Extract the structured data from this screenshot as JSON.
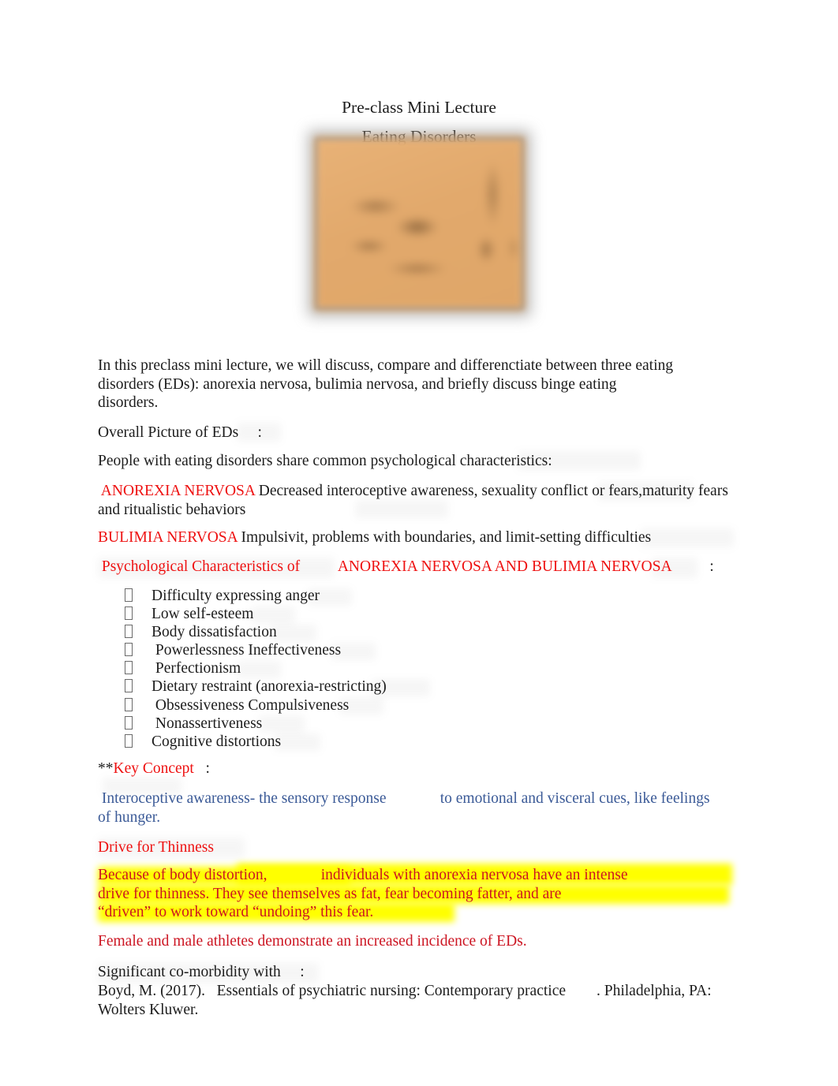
{
  "document": {
    "title_line_1": "Pre-class Mini Lecture",
    "title_line_2": "Eating Disorders",
    "image_alt": "blurred-lecture-photo"
  },
  "intro": {
    "paragraph": "In this preclass mini lecture, we will discuss, compare and differenctiate between three eating disorders (EDs):   anorexia nervosa, bulimia nervosa, and briefly discuss binge eating disorders.",
    "overall_heading": "Overall Picture of EDs",
    "overall_colon": ":",
    "shared_characteristics": " People with eating disorders share common psychological characteristics:"
  },
  "anorexia": {
    "label": " ANOREXIA NERVOSA",
    "body": "       Decreased interoceptive awareness, sexuality conflict or fears,maturity fears and ritualistic behaviors"
  },
  "bulimia": {
    "label": "BULIMIA NERVOSA",
    "body": "      Impulsivit, problems with boundaries, and limit-setting difficulties"
  },
  "psych_characteristics": {
    "heading_left": " Psychological Characteristics of",
    "heading_right": "ANOREXIA NERVOSA AND BULIMIA NERVOSA",
    "heading_colon": ":",
    "bullet_glyph": "missing-glyph-box",
    "items": [
      "Difficulty expressing anger",
      "Low self-esteem",
      "Body dissatisfaction",
      " Powerlessness Ineffectiveness",
      " Perfectionism",
      "Dietary restraint (anorexia-restricting)",
      " Obsessiveness Compulsiveness",
      " Nonassertiveness",
      "Cognitive distortions"
    ]
  },
  "key_concept": {
    "asterisks": "**",
    "label": "Key Concept",
    "colon": ":",
    "definition_part_1": " Interoceptive awareness- the sensory response",
    "definition_part_2": "to emotional and visceral cues, like feelings of hunger."
  },
  "drive_for_thinness": {
    "heading": "Drive for Thinness",
    "highlighted_line_1a": "Because of body distortion,",
    "highlighted_line_1b": "individuals with anorexia nervosa have an intense",
    "highlighted_line_2": "drive for thinness. They see themselves as fat, fear becoming fatter, and are",
    "highlighted_line_3": "“driven” to work toward “undoing” this fear.",
    "athletes_note": "Female and male athletes demonstrate an increased incidence of EDs."
  },
  "footer": {
    "comorbidity_heading": "Significant co-morbidity with",
    "comorbidity_colon": ":",
    "citation_part_1": "Boyd, M. (2017).   Essentials of psychiatric nursing: Contemporary practice",
    "citation_part_2": ". Philadelphia, PA: Wolters Kluwer."
  },
  "colors": {
    "red": "#ee1111",
    "red_dark": "#cc1522",
    "blue": "#3b5a97",
    "highlight_yellow": "#ffff00",
    "body_text": "#1c1c1c",
    "photo_tan": "#e2a96c"
  }
}
